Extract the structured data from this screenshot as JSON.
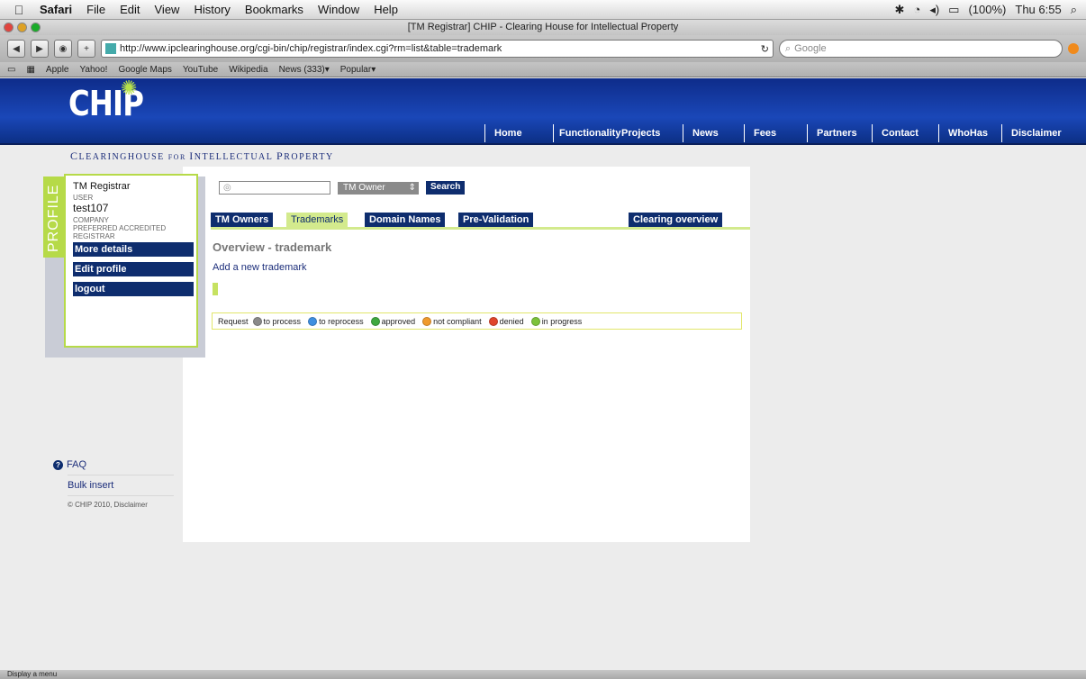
{
  "menubar": {
    "app": "Safari",
    "items": [
      "File",
      "Edit",
      "View",
      "History",
      "Bookmarks",
      "Window",
      "Help"
    ],
    "battery": "(100%)",
    "clock": "Thu 6:55"
  },
  "window": {
    "title": "[TM Registrar] CHIP - Clearing House for Intellectual Property"
  },
  "toolbar": {
    "url": "http://www.ipclearinghouse.org/cgi-bin/chip/registrar/index.cgi?rm=list&table=trademark",
    "search_placeholder": "Google"
  },
  "bookmarks": [
    "Apple",
    "Yahoo!",
    "Google Maps",
    "YouTube",
    "Wikipedia",
    "News (333)▾",
    "Popular▾"
  ],
  "site": {
    "logo": "CHIP",
    "tagline_parts": [
      "C",
      "LEARINGHOUSE ",
      "FOR ",
      "I",
      "NTELLECTUAL ",
      "P",
      "ROPERTY"
    ],
    "nav": [
      "Home",
      "Functionality",
      "Projects",
      "News",
      "Fees",
      "Partners",
      "Contact",
      "WhoHas",
      "Disclaimer"
    ]
  },
  "profile": {
    "side_label": "PROFILE",
    "role": "TM Registrar",
    "user_label": "USER",
    "user": "test107",
    "company_label": "COMPANY",
    "company": "PREFERRED ACCREDITED REGISTRAR",
    "buttons": [
      "More details",
      "Edit profile",
      "logout"
    ]
  },
  "search": {
    "select_value": "TM Owner",
    "button": "Search"
  },
  "tabs": {
    "items": [
      "TM Owners",
      "Trademarks",
      "Domain Names",
      "Pre-Validation",
      "Clearing overview"
    ],
    "active": "Trademarks"
  },
  "main": {
    "title": "Overview - trademark",
    "add_link": "Add a new trademark"
  },
  "legend": {
    "label": "Request",
    "items": [
      {
        "label": "to process",
        "color": "#8a8a8a"
      },
      {
        "label": "to reprocess",
        "color": "#3f8fe0"
      },
      {
        "label": "approved",
        "color": "#3fa83f"
      },
      {
        "label": "not compliant",
        "color": "#f09a2c"
      },
      {
        "label": "denied",
        "color": "#e0452b"
      },
      {
        "label": "in progress",
        "color": "#7bc23a"
      }
    ]
  },
  "footer": {
    "faq": "FAQ",
    "bulk": "Bulk insert",
    "copyright": "© CHIP 2010, Disclaimer"
  },
  "statusbar": "Display a menu"
}
